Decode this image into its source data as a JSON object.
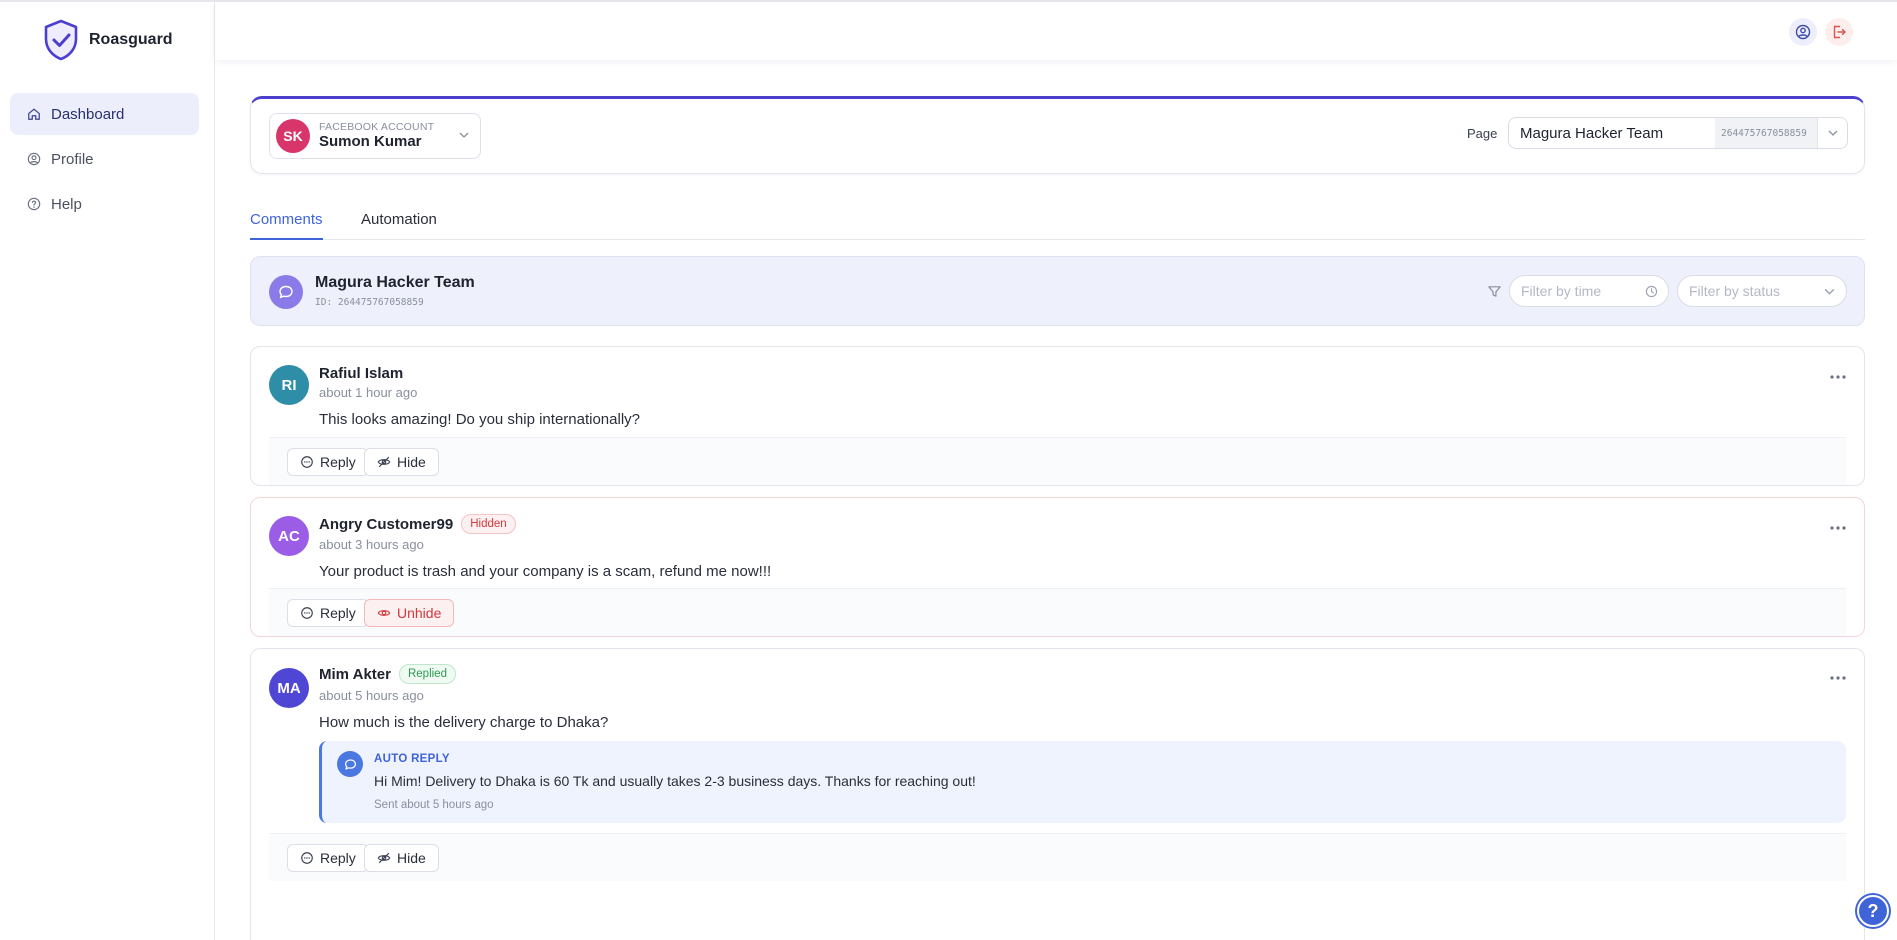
{
  "brand": {
    "name": "Roasguard",
    "accent": "#4c3fd0"
  },
  "sidebar": {
    "items": [
      {
        "label": "Dashboard",
        "icon": "home-icon",
        "active": true
      },
      {
        "label": "Profile",
        "icon": "user-circle-icon",
        "active": false
      },
      {
        "label": "Help",
        "icon": "help-circle-icon",
        "active": false
      }
    ]
  },
  "header": {
    "icons": [
      "user-circle-icon",
      "logout-icon"
    ]
  },
  "account": {
    "label": "FACEBOOK ACCOUNT",
    "initials": "SK",
    "name": "Sumon Kumar",
    "avatar_color": "#d8356b"
  },
  "page_select": {
    "label": "Page",
    "value": "Magura Hacker Team",
    "id": "264475767058859"
  },
  "tabs": [
    {
      "label": "Comments",
      "active": true
    },
    {
      "label": "Automation",
      "active": false
    }
  ],
  "page_header": {
    "title": "Magura Hacker Team",
    "id_text": "ID: 264475767058859",
    "filter_time_placeholder": "Filter by time",
    "filter_status_placeholder": "Filter by status"
  },
  "comments": [
    {
      "initials": "RI",
      "avatar_color": "#2e8ea8",
      "author": "Rafiul Islam",
      "badge": "",
      "time": "about 1 hour ago",
      "text": "This looks amazing! Do you ship internationally?",
      "actions": [
        "Reply",
        "Hide"
      ]
    },
    {
      "initials": "AC",
      "avatar_color": "#9b5ce6",
      "author": "Angry Customer99",
      "badge": "Hidden",
      "time": "about 3 hours ago",
      "text": "Your product is trash and your company is a scam, refund me now!!!",
      "actions": [
        "Reply",
        "Unhide"
      ]
    },
    {
      "initials": "MA",
      "avatar_color": "#4f46d6",
      "author": "Mim Akter",
      "badge": "Replied",
      "time": "about 5 hours ago",
      "text": "How much is the delivery charge to Dhaka?",
      "auto_reply": {
        "label": "AUTO REPLY",
        "text": "Hi Mim! Delivery to Dhaka is 60 Tk and usually takes 2-3 business days. Thanks for reaching out!",
        "time": "Sent about 5 hours ago"
      },
      "actions": [
        "Reply",
        "Hide"
      ]
    }
  ],
  "help_fab": {
    "label": "?"
  }
}
